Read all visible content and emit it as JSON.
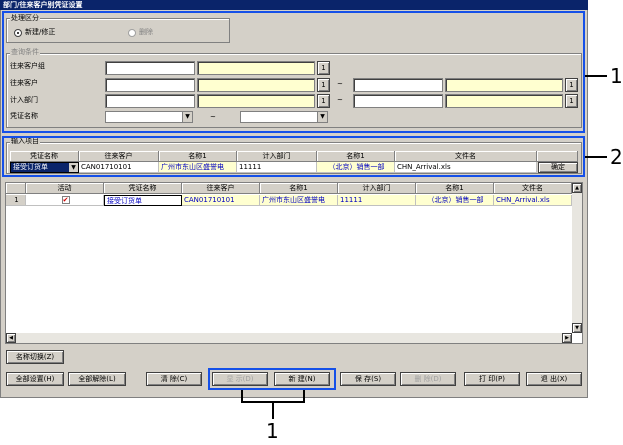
{
  "window_title": "部门/往来客户别凭证设置",
  "process": {
    "legend": "处理区分",
    "opt_new": "新建/修正",
    "opt_delete": "删除"
  },
  "query": {
    "legend": "查询条件",
    "row1": "往来客户组",
    "row2": "往来客户",
    "row3": "计入部门",
    "row4": "凭证名称",
    "tilde": "~",
    "lookup": "1"
  },
  "input_section": {
    "legend": "输入项目",
    "headers": [
      "凭证名称",
      "往来客户",
      "名称1",
      "计入部门",
      "名称1",
      "文件名"
    ],
    "values": [
      "接受订货单",
      "CAN01710101",
      "广州市东山区盛誉电",
      "11111",
      "（北京）销售一部",
      "CHN_Arrival.xls"
    ],
    "confirm": "确定"
  },
  "grid": {
    "headers": [
      "",
      "活动",
      "凭证名称",
      "往来客户",
      "名称1",
      "计入部门",
      "名称1",
      "文件名"
    ],
    "rows": [
      [
        "1",
        "✔",
        "接受订货单",
        "CAN01710101",
        "广州市东山区盛誉电",
        "11111",
        "（北京）销售一部",
        "CHN_Arrival.xls"
      ]
    ]
  },
  "buttons": {
    "name_switch": "名称切换(Z)",
    "set_all": "全部设置(H)",
    "clear_all": "全部解除(L)",
    "clear": "清  除(C)",
    "display": "显  示(D)",
    "new": "新  建(N)",
    "save": "保  存(S)",
    "delete": "删  除(D)",
    "print": "打  印(P)",
    "exit": "退  出(X)"
  },
  "callouts": {
    "c1a": "1",
    "c2": "2",
    "c1b": "1"
  },
  "colors": {
    "callout": "#1550e8",
    "title_bar": "#0a246a",
    "highlight": "#ffffd0"
  }
}
